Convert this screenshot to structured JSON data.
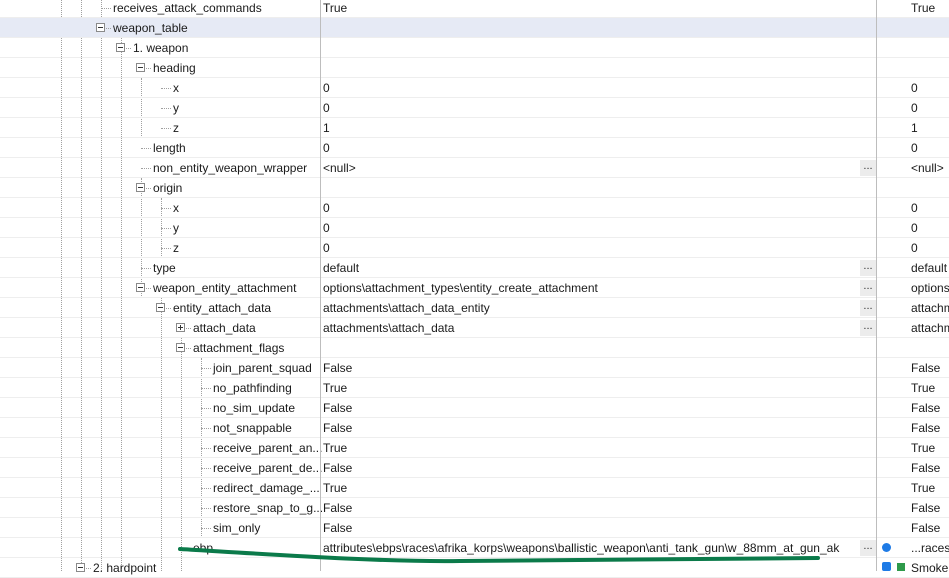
{
  "rows": [
    {
      "name": "receives_attack_commands",
      "value": "True",
      "value2": "True"
    },
    {
      "name": "weapon_table",
      "value": "",
      "value2": ""
    },
    {
      "name": "1. weapon",
      "value": "",
      "value2": ""
    },
    {
      "name": "heading",
      "value": "",
      "value2": ""
    },
    {
      "name": "x",
      "value": "0",
      "value2": "0"
    },
    {
      "name": "y",
      "value": "0",
      "value2": "0"
    },
    {
      "name": "z",
      "value": "1",
      "value2": "1"
    },
    {
      "name": "length",
      "value": "0",
      "value2": "0"
    },
    {
      "name": "non_entity_weapon_wrapper",
      "value": "<null>",
      "value2": "<null>"
    },
    {
      "name": "origin",
      "value": "",
      "value2": ""
    },
    {
      "name": "x",
      "value": "0",
      "value2": "0"
    },
    {
      "name": "y",
      "value": "0",
      "value2": "0"
    },
    {
      "name": "z",
      "value": "0",
      "value2": "0"
    },
    {
      "name": "type",
      "value": "default",
      "value2": "default"
    },
    {
      "name": "weapon_entity_attachment",
      "value": "options\\attachment_types\\entity_create_attachment",
      "value2": "options"
    },
    {
      "name": "entity_attach_data",
      "value": "attachments\\attach_data_entity",
      "value2": "attachm"
    },
    {
      "name": "attach_data",
      "value": "attachments\\attach_data",
      "value2": "attachm"
    },
    {
      "name": "attachment_flags",
      "value": "",
      "value2": ""
    },
    {
      "name": "join_parent_squad",
      "value": "False",
      "value2": "False"
    },
    {
      "name": "no_pathfinding",
      "value": "True",
      "value2": "True"
    },
    {
      "name": "no_sim_update",
      "value": "False",
      "value2": "False"
    },
    {
      "name": "not_snappable",
      "value": "False",
      "value2": "False"
    },
    {
      "name": "receive_parent_an...",
      "value": "True",
      "value2": "True"
    },
    {
      "name": "receive_parent_de...",
      "value": "False",
      "value2": "False"
    },
    {
      "name": "redirect_damage_...",
      "value": "True",
      "value2": "True"
    },
    {
      "name": "restore_snap_to_g...",
      "value": "False",
      "value2": "False"
    },
    {
      "name": "sim_only",
      "value": "False",
      "value2": "False"
    },
    {
      "name": "ebp",
      "value": "attributes\\ebps\\races\\afrika_korps\\weapons\\ballistic_weapon\\anti_tank_gun\\w_88mm_at_gun_ak",
      "value2": "...races\\"
    },
    {
      "name": "2. hardpoint",
      "value": "",
      "value2": "Smoke"
    }
  ],
  "ellipsis_label": "...",
  "colors": {
    "selected_row": "#e6eaf5",
    "accent_underline": "#0b7a4a",
    "link_dot": "#1e7be6"
  }
}
